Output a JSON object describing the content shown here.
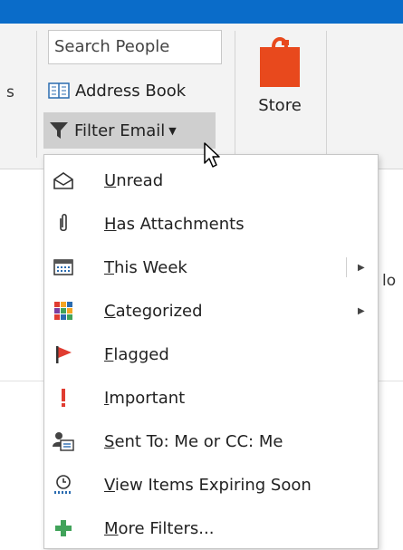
{
  "ribbon": {
    "left_fragment": "s",
    "search_placeholder": "Search People",
    "address_book_label": "Address Book",
    "filter_email_label": "Filter Email",
    "store_label": "Store"
  },
  "background": {
    "right_fragment": "lo"
  },
  "menu": {
    "items": [
      {
        "label": "Unread",
        "accel": "U",
        "rest": "nread",
        "icon": "envelope-open-icon"
      },
      {
        "label": "Has Attachments",
        "accel": "H",
        "rest": "as Attachments",
        "icon": "paperclip-icon"
      },
      {
        "label": "This Week",
        "accel": "T",
        "rest": "his Week",
        "icon": "calendar-icon",
        "submenu": true
      },
      {
        "label": "Categorized",
        "accel": "C",
        "rest": "ategorized",
        "icon": "category-icon",
        "submenu": true
      },
      {
        "label": "Flagged",
        "accel": "F",
        "rest": "lagged",
        "icon": "flag-icon"
      },
      {
        "label": "Important",
        "accel": "I",
        "rest": "mportant",
        "icon": "important-icon"
      },
      {
        "label": "Sent To: Me or CC: Me",
        "accel": "S",
        "rest": "ent To: Me or CC: Me",
        "icon": "person-card-icon"
      },
      {
        "label": "View Items Expiring Soon",
        "accel": "V",
        "rest": "iew Items Expiring Soon",
        "icon": "expiring-clock-icon"
      },
      {
        "label": "More Filters...",
        "accel": "M",
        "rest": "ore Filters...",
        "icon": "plus-icon"
      }
    ]
  },
  "colors": {
    "titlebar": "#0a6cc9",
    "store_bag": "#e8491d",
    "flag_red": "#e03c31",
    "plus_green": "#41a35a"
  }
}
